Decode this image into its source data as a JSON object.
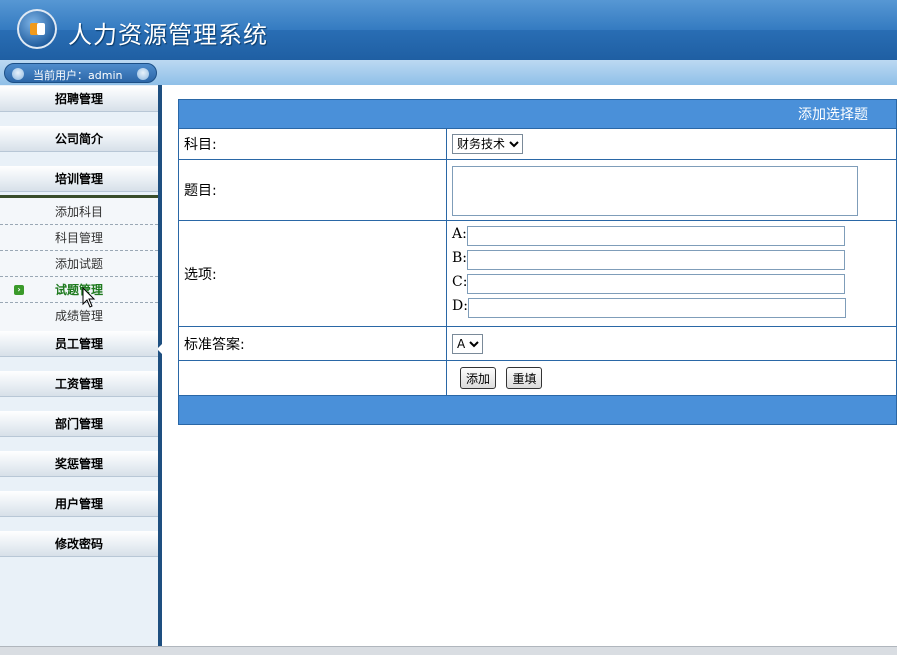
{
  "header": {
    "title": "人力资源管理系统"
  },
  "userbar": {
    "label": "当前用户：admin"
  },
  "sidebar": {
    "menus": [
      {
        "label": "招聘管理"
      },
      {
        "label": "公司简介"
      },
      {
        "label": "培训管理"
      },
      {
        "label": "员工管理"
      },
      {
        "label": "工资管理"
      },
      {
        "label": "部门管理"
      },
      {
        "label": "奖惩管理"
      },
      {
        "label": "用户管理"
      },
      {
        "label": "修改密码"
      }
    ],
    "training_items": [
      {
        "label": "添加科目"
      },
      {
        "label": "科目管理"
      },
      {
        "label": "添加试题"
      },
      {
        "label": "试题管理"
      },
      {
        "label": "成绩管理"
      }
    ]
  },
  "form": {
    "title": "添加选择题",
    "subject_label": "科目:",
    "subject_value": "财务技术",
    "question_label": "题目:",
    "question_value": "",
    "options_label": "选项:",
    "options": [
      {
        "letter": "A:",
        "value": ""
      },
      {
        "letter": "B:",
        "value": ""
      },
      {
        "letter": "C:",
        "value": ""
      },
      {
        "letter": "D:",
        "value": ""
      }
    ],
    "answer_label": "标准答案:",
    "answer_value": "A",
    "add_button": "添加",
    "reset_button": "重填"
  },
  "colors": {
    "header": "#2a6fb6",
    "table_title": "#4a90d9",
    "border": "#2a67a6",
    "sidebar_border": "#1e4f80"
  }
}
